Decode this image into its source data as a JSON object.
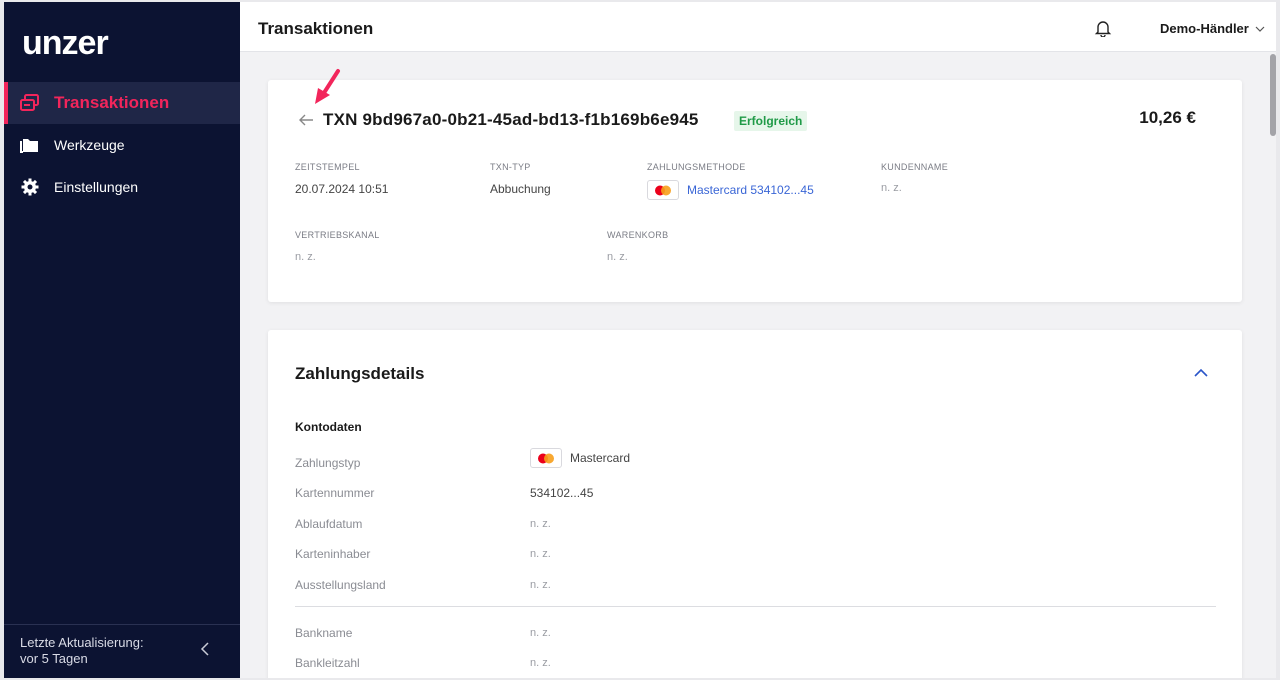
{
  "sidebar": {
    "logo_text": "unzer",
    "items": [
      {
        "label": "Transaktionen",
        "icon": "transactions-icon",
        "active": true
      },
      {
        "label": "Werkzeuge",
        "icon": "folder-icon",
        "active": false
      },
      {
        "label": "Einstellungen",
        "icon": "gear-icon",
        "active": false
      }
    ],
    "footer_line1": "Letzte Aktualisierung:",
    "footer_line2": "vor 5 Tagen"
  },
  "header": {
    "title": "Transaktionen",
    "merchant": "Demo-Händler"
  },
  "transaction": {
    "title": "TXN 9bd967a0-0b21-45ad-bd13-f1b169b6e945",
    "status": "Erfolgreich",
    "amount": "10,26 €",
    "fields": {
      "timestamp_label": "ZEITSTEMPEL",
      "timestamp_value": "20.07.2024 10:51",
      "type_label": "TXN-TYP",
      "type_value": "Abbuchung",
      "method_label": "ZAHLUNGSMETHODE",
      "method_value": "Mastercard 534102...45",
      "customer_label": "KUNDENNAME",
      "customer_value": "n. z.",
      "channel_label": "VERTRIEBSKANAL",
      "channel_value": "n. z.",
      "basket_label": "WARENKORB",
      "basket_value": "n. z."
    }
  },
  "payment_details": {
    "title": "Zahlungsdetails",
    "section": "Kontodaten",
    "rows": [
      {
        "label": "Zahlungstyp",
        "value": "Mastercard"
      },
      {
        "label": "Kartennummer",
        "value": "534102...45"
      },
      {
        "label": "Ablaufdatum",
        "value": "n. z."
      },
      {
        "label": "Karteninhaber",
        "value": "n. z."
      },
      {
        "label": "Ausstellungsland",
        "value": "n. z."
      },
      {
        "label": "Bankname",
        "value": "n. z."
      },
      {
        "label": "Bankleitzahl",
        "value": "n. z."
      }
    ]
  },
  "colors": {
    "sidebar_bg": "#0c1332",
    "accent": "#f2255b",
    "success": "#1f9a47",
    "link": "#3a66d6"
  }
}
